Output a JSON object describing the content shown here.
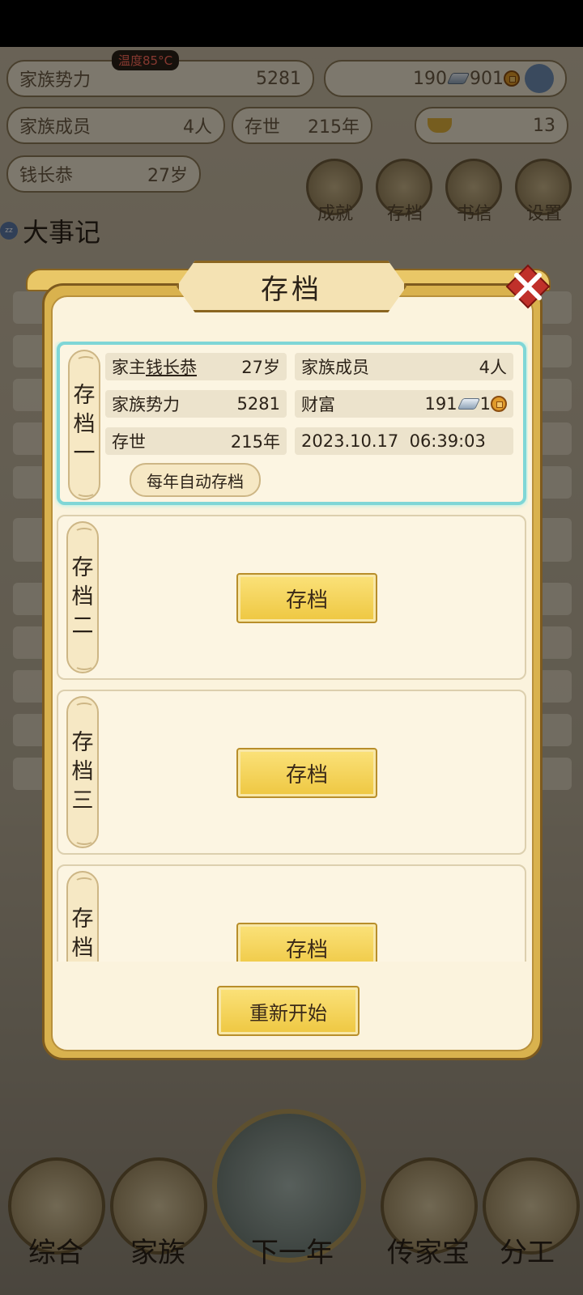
{
  "background": {
    "temperature": "温度85°C",
    "family_power_label": "家族势力",
    "family_power_value": "5281",
    "currency_silver": "190",
    "currency_coin": "901",
    "members_label": "家族成员",
    "members_value": "4人",
    "existence_label": "存世",
    "existence_value": "215年",
    "gold_value": "13",
    "patriarch_name": "钱长恭",
    "patriarch_age": "27岁",
    "menu": [
      "成就",
      "存档",
      "书信",
      "设置"
    ],
    "events_title": "大事记",
    "nav": [
      "综合",
      "家族",
      "下一年",
      "传家宝",
      "分工"
    ]
  },
  "modal": {
    "title": "存档",
    "slot1": {
      "tag": [
        "存",
        "档",
        "一"
      ],
      "patriarch_label": "家主",
      "patriarch_name": "钱长恭",
      "patriarch_age": "27岁",
      "members_label": "家族成员",
      "members_value": "4人",
      "power_label": "家族势力",
      "power_value": "5281",
      "wealth_label": "财富",
      "wealth_silver": "191",
      "wealth_coin": "1",
      "existence_label": "存世",
      "existence_value": "215年",
      "saved_at": "2023.10.17  06:39:03",
      "auto_save": "每年自动存档"
    },
    "slot2": {
      "tag": [
        "存",
        "档",
        "二"
      ],
      "button": "存档"
    },
    "slot3": {
      "tag": [
        "存",
        "档",
        "三"
      ],
      "button": "存档"
    },
    "slot4": {
      "tag": [
        "存",
        "档"
      ],
      "button": "存档"
    },
    "restart_button": "重新开始"
  },
  "colors": {
    "accent_gold": "#eec741",
    "active_border": "#7fd6d6",
    "panel": "#fbf3dd"
  }
}
